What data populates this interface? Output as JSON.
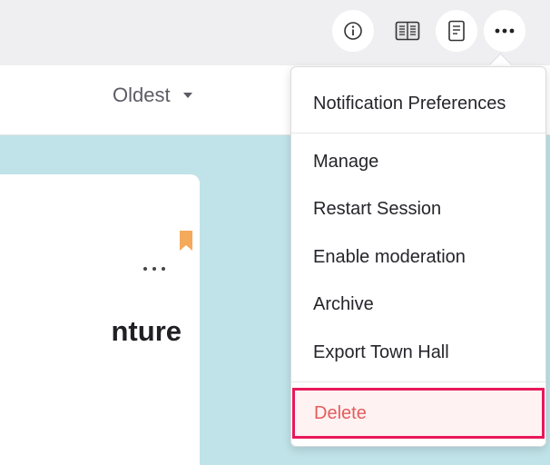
{
  "toolbar": {
    "buttons": [
      {
        "icon": "info-icon"
      },
      {
        "icon": "reader-view-icon"
      },
      {
        "icon": "document-icon"
      },
      {
        "icon": "more-options-icon"
      }
    ]
  },
  "sort": {
    "label": "Oldest"
  },
  "card": {
    "title_fragment": "nture",
    "bookmark_color": "#f5a95b"
  },
  "menu": {
    "items": [
      {
        "label": "Notification Preferences"
      },
      {
        "label": "Manage"
      },
      {
        "label": "Restart Session"
      },
      {
        "label": "Enable moderation"
      },
      {
        "label": "Archive"
      },
      {
        "label": "Export Town Hall"
      },
      {
        "label": "Delete",
        "variant": "danger"
      }
    ],
    "danger_color": "#e35d5d",
    "highlight_color": "#e8185a"
  }
}
